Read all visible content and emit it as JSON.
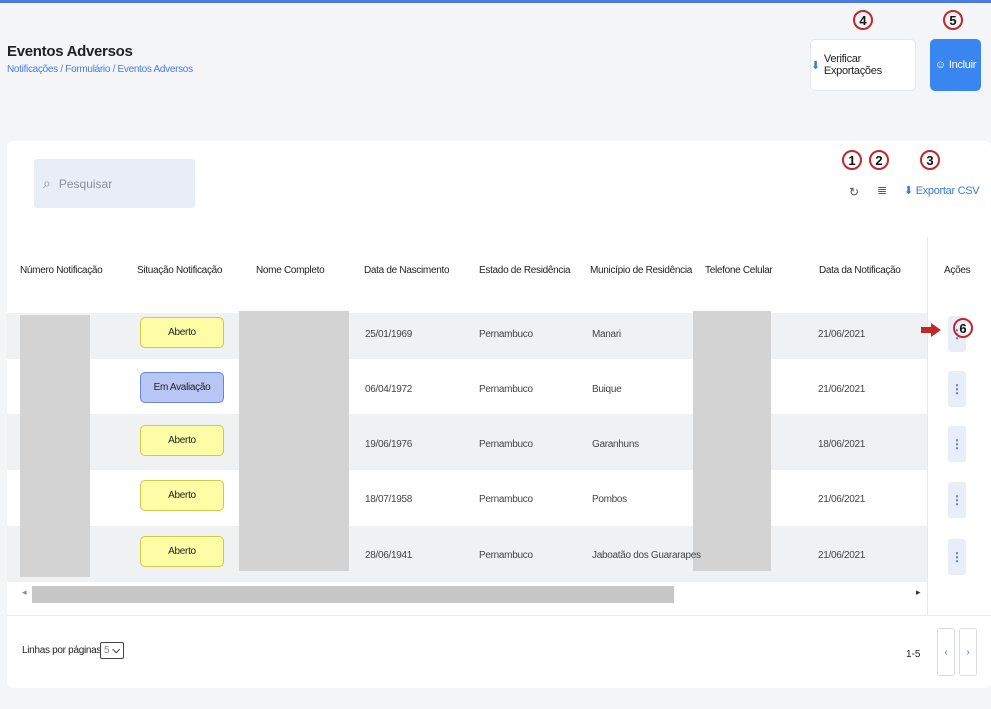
{
  "header": {
    "title": "Eventos Adversos",
    "breadcrumb": "Notificações / Formulário / Eventos Adversos",
    "verify_exports_label": "Verificar Exportações",
    "include_label": "Incluir"
  },
  "toolbar": {
    "search_placeholder": "Pesquisar",
    "export_csv_label": "Exportar CSV"
  },
  "markers": [
    "1",
    "2",
    "3",
    "4",
    "5",
    "6"
  ],
  "table": {
    "columns": [
      "Número Notificação",
      "Situação Notificação",
      "Nome Completo",
      "Data de Nascimento",
      "Estado de Residência",
      "Município de Residência",
      "Telefone Celular",
      "Data da Notificação",
      "Ações"
    ],
    "rows": [
      {
        "status": "Aberto",
        "status_type": "open",
        "birth_date": "25/01/1969",
        "state": "Pernambuco",
        "city": "Manari",
        "notification_date": "21/06/2021"
      },
      {
        "status": "Em Avaliação",
        "status_type": "eval",
        "birth_date": "06/04/1972",
        "state": "Pernambuco",
        "city": "Buique",
        "notification_date": "21/06/2021"
      },
      {
        "status": "Aberto",
        "status_type": "open",
        "birth_date": "19/06/1976",
        "state": "Pernambuco",
        "city": "Garanhuns",
        "notification_date": "18/06/2021"
      },
      {
        "status": "Aberto",
        "status_type": "open",
        "birth_date": "18/07/1958",
        "state": "Pernambuco",
        "city": "Pombos",
        "notification_date": "21/06/2021"
      },
      {
        "status": "Aberto",
        "status_type": "open",
        "birth_date": "28/06/1941",
        "state": "Pernambuco",
        "city": "Jaboatão dos Guararapes",
        "notification_date": "21/06/2021"
      }
    ]
  },
  "footer": {
    "rows_per_page_label": "Linhas por páginas",
    "rows_per_page_value": "5",
    "range": "1-5"
  },
  "colors": {
    "accent": "#3a86f0",
    "status_open": "#fdfda6",
    "status_eval": "#b8c6f5",
    "marker_ring": "#c0282a"
  }
}
